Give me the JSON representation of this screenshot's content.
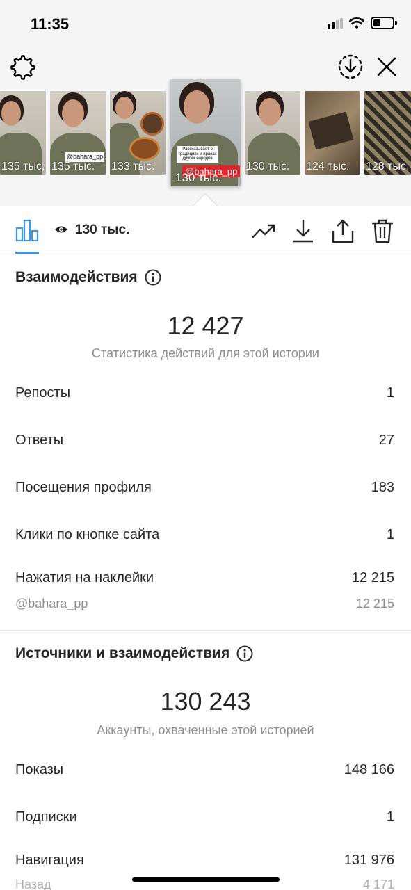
{
  "status_bar": {
    "time": "11:35"
  },
  "colors": {
    "accent": "#3897f0",
    "text": "#262626",
    "muted": "#8e8e8e",
    "tag_red": "#e0262c"
  },
  "header": {
    "left_icon": "gear-icon",
    "right_icons": [
      "download-circle-icon",
      "close-icon"
    ]
  },
  "thumbnails": [
    {
      "views": "135 тыс.",
      "selected": false
    },
    {
      "views": "135 тыс.",
      "caption": "@bahara_pp",
      "selected": false
    },
    {
      "views": "133 тыс.",
      "selected": false
    },
    {
      "views": "130 тыс.",
      "caption": "Рассказывает о традициях и правах других народов",
      "handle": "@bahara_pp",
      "selected": true
    },
    {
      "views": "130 тыс.",
      "selected": false
    },
    {
      "views": "124 тыс.",
      "selected": false
    },
    {
      "views": "128 тыс.",
      "selected": false
    }
  ],
  "action_bar": {
    "views": "130 тыс.",
    "icons": [
      "bar-chart-icon",
      "eye-icon",
      "trending-icon",
      "download-icon",
      "share-icon",
      "trash-icon"
    ]
  },
  "interactions": {
    "title": "Взаимодействия",
    "total": "12 427",
    "caption": "Статистика действий для этой истории",
    "rows": [
      {
        "label": "Репосты",
        "value": "1"
      },
      {
        "label": "Ответы",
        "value": "27"
      },
      {
        "label": "Посещения профиля",
        "value": "183"
      },
      {
        "label": "Клики по кнопке сайта",
        "value": "1"
      },
      {
        "label": "Нажатия на наклейки",
        "value": "12 215"
      }
    ],
    "sub_row": {
      "label": "@bahara_pp",
      "value": "12 215"
    }
  },
  "discovery": {
    "title": "Источники и взаимодействия",
    "total": "130 243",
    "caption": "Аккаунты, охваченные этой историей",
    "rows": [
      {
        "label": "Показы",
        "value": "148 166"
      },
      {
        "label": "Подписки",
        "value": "1"
      },
      {
        "label": "Навигация",
        "value": "131 976"
      },
      {
        "label": "Назад",
        "value": "4 171"
      }
    ]
  }
}
